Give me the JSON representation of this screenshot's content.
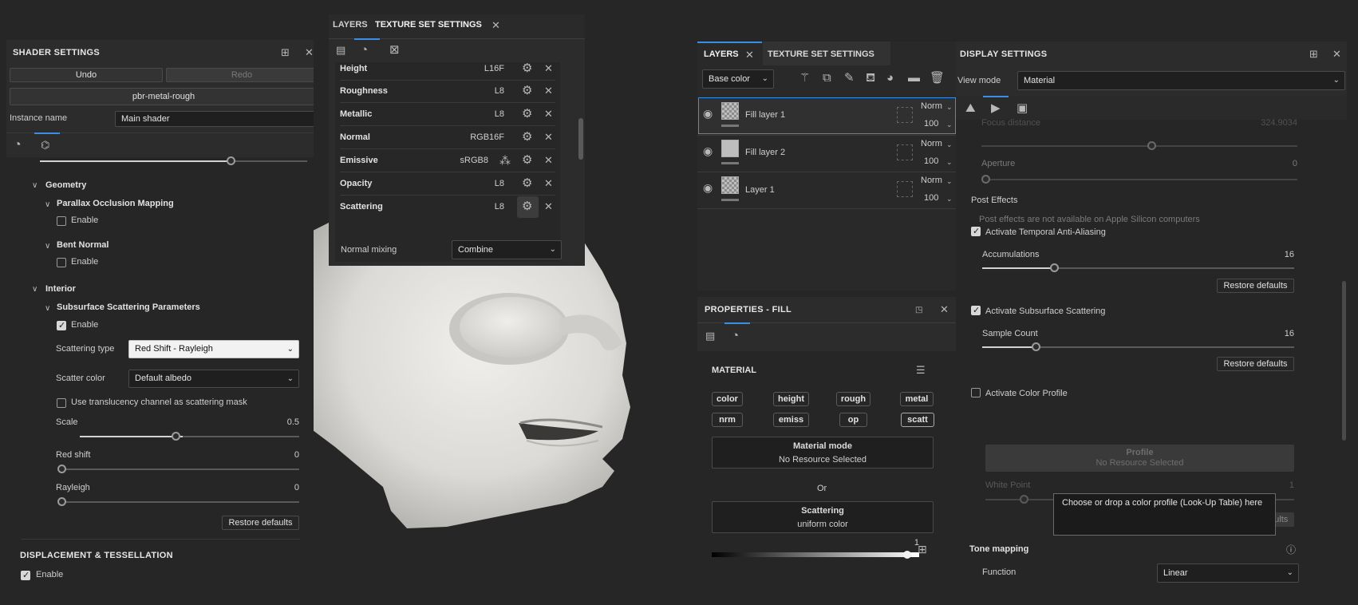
{
  "shader": {
    "title": "SHADER SETTINGS",
    "undo": "Undo",
    "redo": "Redo",
    "shader_name": "pbr-metal-rough",
    "instance_label": "Instance name",
    "instance_value": "Main shader",
    "geometry": "Geometry",
    "pom": "Parallax Occlusion Mapping",
    "enable": "Enable",
    "bent_normal": "Bent Normal",
    "interior": "Interior",
    "sss_params": "Subsurface Scattering Parameters",
    "scattering_type_label": "Scattering type",
    "scattering_type_value": "Red Shift - Rayleigh",
    "scatter_color_label": "Scatter color",
    "scatter_color_value": "Default albedo",
    "translucency": "Use translucency channel as scattering mask",
    "scale_label": "Scale",
    "scale_value": "0.5",
    "scale_fraction": 0.47,
    "red_shift_label": "Red shift",
    "red_shift_value": "0",
    "rayleigh_label": "Rayleigh",
    "rayleigh_value": "0",
    "restore": "Restore defaults",
    "displacement": "DISPLACEMENT & TESSELLATION"
  },
  "texset1": {
    "tab_layers": "LAYERS",
    "tab_texset": "TEXTURE SET SETTINGS",
    "channels": [
      {
        "name": "Height",
        "format": "L16F"
      },
      {
        "name": "Roughness",
        "format": "L8"
      },
      {
        "name": "Metallic",
        "format": "L8"
      },
      {
        "name": "Normal",
        "format": "RGB16F"
      },
      {
        "name": "Emissive",
        "format": "sRGB8"
      },
      {
        "name": "Opacity",
        "format": "L8"
      },
      {
        "name": "Scattering",
        "format": "L8"
      }
    ],
    "normal_mixing_label": "Normal mixing",
    "normal_mixing_value": "Combine"
  },
  "layers": {
    "tab_layers": "LAYERS",
    "tab_texset": "TEXTURE SET SETTINGS",
    "channel_select": "Base color",
    "items": [
      {
        "name": "Fill layer 1",
        "blend": "Norm",
        "opacity": "100"
      },
      {
        "name": "Fill layer 2",
        "blend": "Norm",
        "opacity": "100"
      },
      {
        "name": "Layer 1",
        "blend": "Norm",
        "opacity": "100"
      }
    ]
  },
  "props": {
    "title": "PROPERTIES - FILL",
    "material": "MATERIAL",
    "tags": [
      "color",
      "height",
      "rough",
      "metal",
      "nrm",
      "emiss",
      "op",
      "scatt"
    ],
    "mode_title": "Material mode",
    "mode_value": "No Resource Selected",
    "or": "Or",
    "scattering_title": "Scattering",
    "scattering_value": "uniform color",
    "slider_value": "1"
  },
  "display": {
    "title": "DISPLAY SETTINGS",
    "view_mode_label": "View mode",
    "view_mode_value": "Material",
    "focus_distance_label": "Focus distance",
    "focus_distance_value": "324.9034",
    "aperture_label": "Aperture",
    "aperture_value": "0",
    "post_effects": "Post Effects",
    "post_effects_note": "Post effects are not available on Apple Silicon computers",
    "taa": "Activate Temporal Anti-Aliasing",
    "accumulations_label": "Accumulations",
    "accumulations_value": "16",
    "restore": "Restore defaults",
    "sss": "Activate Subsurface Scattering",
    "sample_count_label": "Sample Count",
    "sample_count_value": "16",
    "color_profile": "Activate Color Profile",
    "profile_title": "Profile",
    "profile_value": "No Resource Selected",
    "white_point_label": "White Point",
    "white_point_value": "1",
    "defaults_fragment": "defaults",
    "tooltip": "Choose or drop a color profile (Look-Up Table) here",
    "tone_mapping": "Tone mapping",
    "function_label": "Function",
    "function_value": "Linear"
  },
  "colors": {
    "accent": "#3a8ee6",
    "panel": "#2c2c2c",
    "background": "#262626"
  }
}
